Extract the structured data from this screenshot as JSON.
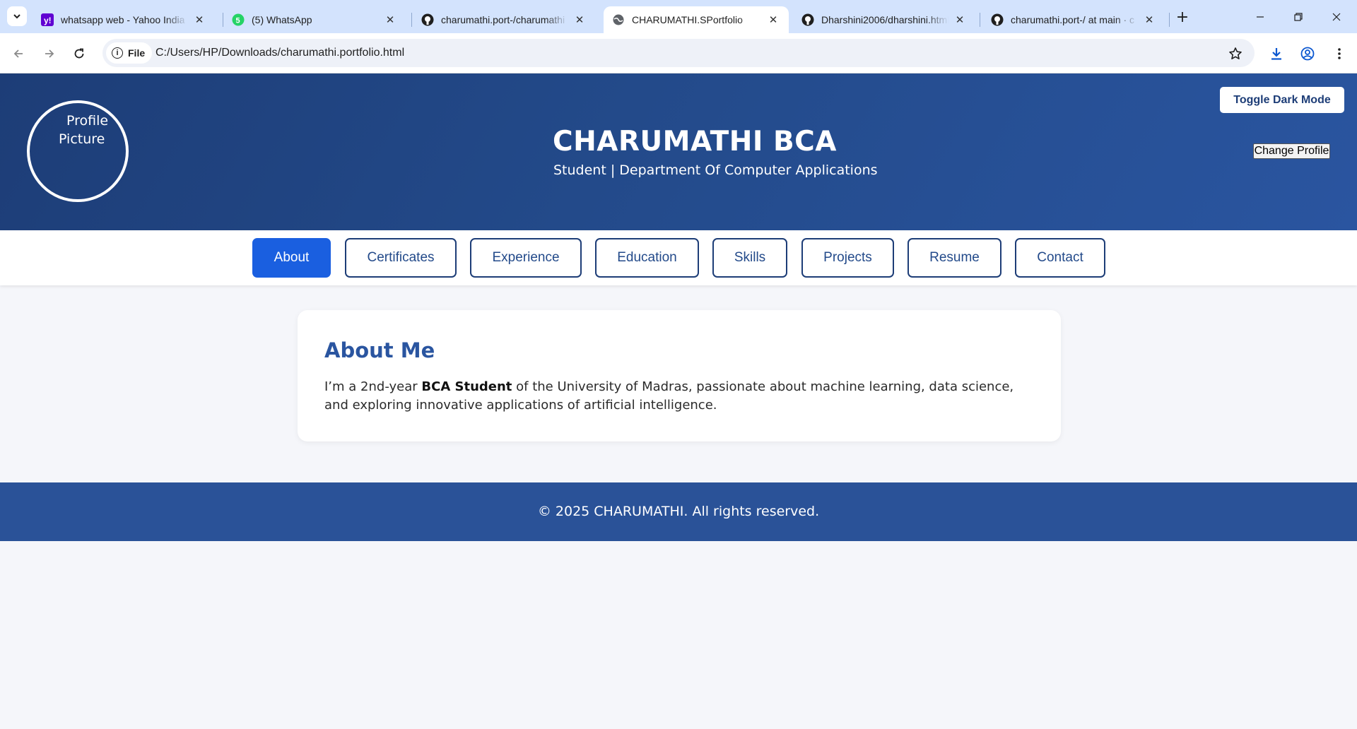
{
  "browser": {
    "tabs": [
      {
        "title": "whatsapp web - Yahoo India",
        "icon": "yahoo-icon",
        "active": false
      },
      {
        "title": "(5) WhatsApp",
        "icon": "whatsapp-icon",
        "badge": "5",
        "active": false
      },
      {
        "title": "charumathi.port-/charumathi",
        "icon": "github-icon",
        "active": false
      },
      {
        "title": "CHARUMATHI.SPortfolio",
        "icon": "globe-icon",
        "active": true
      },
      {
        "title": "Dharshini2006/dharshini.html",
        "icon": "github-icon",
        "active": false
      },
      {
        "title": "charumathi.port-/ at main · c",
        "icon": "github-icon",
        "active": false
      }
    ],
    "chip_label": "File",
    "url": "C:/Users/HP/Downloads/charumathi.portfolio.html",
    "colors": {
      "tabbar": "#d3e3fd",
      "omnibox": "#eef1f8"
    }
  },
  "header": {
    "avatar_line1": "Profile",
    "avatar_line2": "Picture",
    "dark_mode_label": "Toggle Dark Mode",
    "name": "CHARUMATHI BCA",
    "subtitle": "Student | Department Of Computer Applications",
    "change_profile_label": "Change Profile"
  },
  "nav": {
    "items": [
      "About",
      "Certificates",
      "Experience",
      "Education",
      "Skills",
      "Projects",
      "Resume",
      "Contact"
    ],
    "active": "About"
  },
  "about": {
    "title": "About Me",
    "text_before": "I’m a 2nd-year ",
    "text_bold": "BCA Student",
    "text_after": " of the University of Madras, passionate about machine learning, data science, and exploring innovative applications of artificial intelligence."
  },
  "footer": {
    "text": "© 2025 CHARUMATHI. All rights reserved."
  },
  "colors": {
    "header_dark": "#1d3d77",
    "header_light": "#2a55a0",
    "accent": "#1a5fe0",
    "footer": "#2a5298",
    "page_bg": "#f5f6fa"
  }
}
